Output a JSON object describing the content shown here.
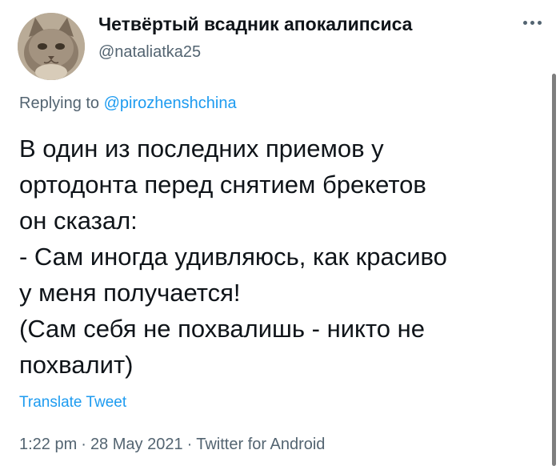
{
  "user": {
    "display_name": "Четвёртый всадник апокалипсиса",
    "handle": "@nataliatka25"
  },
  "reply": {
    "prefix": "Replying to ",
    "to_handle": "@pirozhenshchina"
  },
  "tweet": {
    "lines": [
      "В один из последних приемов у",
      "ортодонта перед снятием брекетов",
      "он сказал:",
      "- Сам иногда удивляюсь, как красиво",
      "у меня получается!",
      "(Сам себя не похвалишь - никто не",
      "похвалит)"
    ],
    "translate_label": "Translate Tweet"
  },
  "meta": {
    "time": "1:22 pm",
    "separator": "·",
    "date": "28 May 2021",
    "client": "Twitter for Android"
  },
  "icons": {
    "avatar": "cat-avatar-photo",
    "more": "more-horizontal-icon"
  },
  "colors": {
    "text": "#0f1419",
    "secondary": "#536471",
    "link": "#1d9bf0"
  }
}
